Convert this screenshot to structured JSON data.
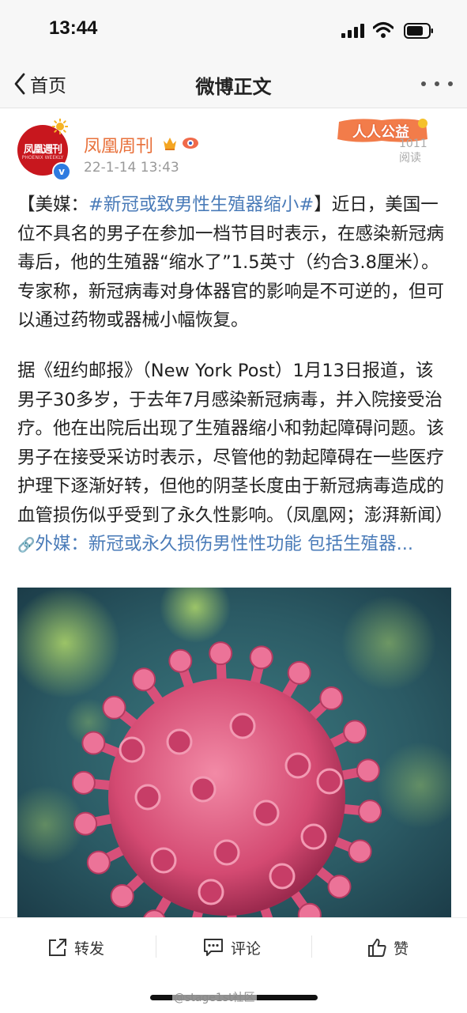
{
  "status_bar": {
    "time": "13:44"
  },
  "nav": {
    "back_label": "首页",
    "title": "微博正文"
  },
  "post": {
    "author": "凤凰周刊",
    "avatar_text": "凤凰週刊",
    "avatar_subtext": "PHOENIX WEEKLY",
    "time": "22-1-14 13:43",
    "promo_label": "人人公益",
    "read_count": "1011",
    "read_label": "阅读",
    "para1_prefix": "【美媒：",
    "topic": "#新冠或致男性生殖器缩小#",
    "para1_text": "】近日，美国一位不具名的男子在参加一档节目时表示，在感染新冠病毒后，他的生殖器“缩水了”1.5英寸（约合3.8厘米）。专家称，新冠病毒对身体器官的影响是不可逆的，但可以通过药物或器械小幅恢复。",
    "para2_text": "据《纽约邮报》（New York Post）1月13日报道，该男子30多岁，于去年7月感染新冠病毒，并入院接受治疗。他在出院后出现了生殖器缩小和勃起障碍问题。该男子在接受采访时表示，尽管他的勃起障碍在一些医疗护理下逐渐好转，但他的阴茎长度由于新冠病毒造成的血管损伤似乎受到了永久性影响。（凤凰网；澎湃新闻）",
    "link_text": "外媒：新冠或永久损伤男性性功能 包括生殖器...",
    "colors": {
      "accent_link": "#4a7bb8",
      "author_name": "#e8703a",
      "avatar_bg": "#c8171e"
    }
  },
  "toolbar": {
    "repost": "转发",
    "comment": "评论",
    "like": "赞"
  },
  "watermark": "@stage1st社区"
}
